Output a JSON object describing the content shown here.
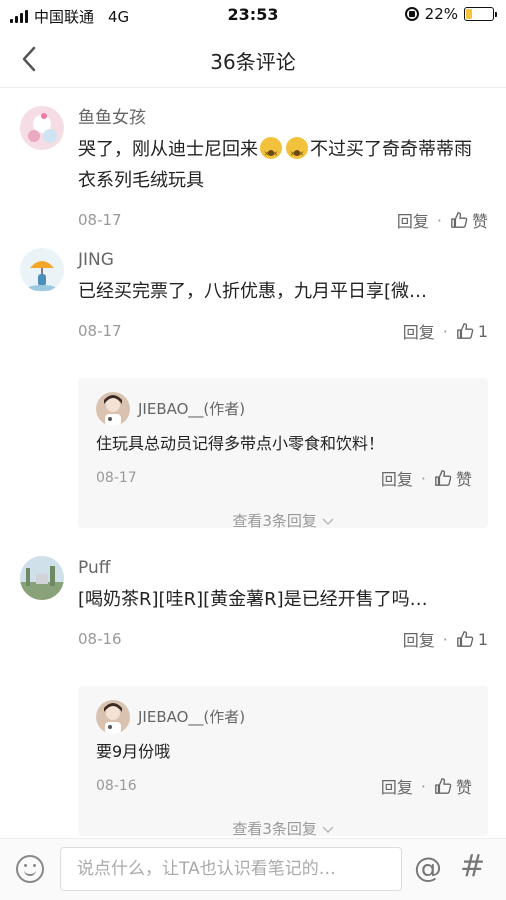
{
  "status_bar": {
    "carrier": "中国联通",
    "network": "4G",
    "time": "23:53",
    "battery_percent": 22,
    "battery_text": "22%"
  },
  "header": {
    "title": "36条评论"
  },
  "comments": [
    {
      "name": "鱼鱼女孩",
      "text_before": "哭了，刚从迪士尼回来",
      "text_after": "不过买了奇奇蒂蒂雨衣系列毛绒玩具",
      "date": "08-17",
      "reply_label": "回复",
      "like_label": "赞"
    },
    {
      "name": "JING",
      "text": "已经买完票了，八折优惠，九月平日享[微…",
      "date": "08-17",
      "reply_label": "回复",
      "like_label": "1",
      "sub_reply": {
        "name": "JIEBAO__(作者)",
        "text": "住玩具总动员记得多带点小零食和饮料！",
        "date": "08-17",
        "reply_label": "回复",
        "like_label": "赞"
      },
      "more_label": "查看3条回复"
    },
    {
      "name": "Puff",
      "text": "[喝奶茶R][哇R][黄金薯R]是已经开售了吗…",
      "date": "08-16",
      "reply_label": "回复",
      "like_label": "1",
      "sub_reply": {
        "name": "JIEBAO__(作者)",
        "text": "要9月份哦",
        "date": "08-16",
        "reply_label": "回复",
        "like_label": "赞"
      },
      "more_label": "查看3条回复"
    }
  ],
  "input": {
    "placeholder": "说点什么，让TA也认识看笔记的…",
    "at_symbol": "@",
    "hash_symbol": "#"
  },
  "colors": {
    "battery": "#f5c242",
    "background": "#ffffff",
    "reply_bg": "#f7f7f7"
  }
}
